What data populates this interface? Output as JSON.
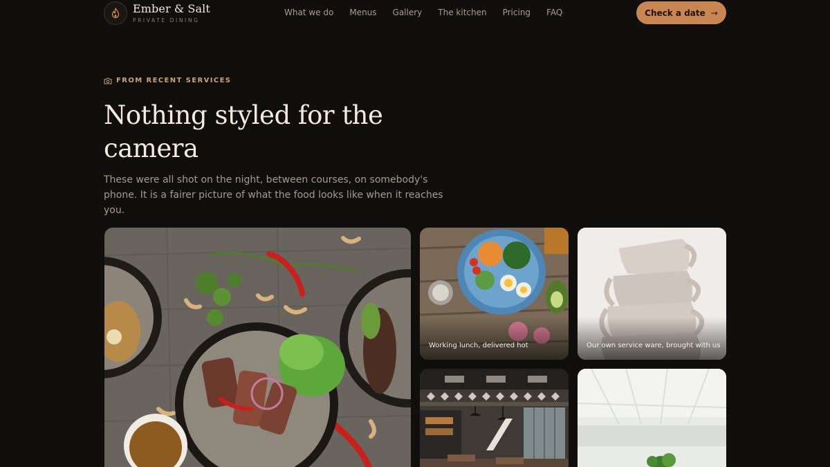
{
  "brand": {
    "name": "Ember & Salt",
    "tagline": "PRIVATE DINING",
    "icon": "flame-icon"
  },
  "nav": {
    "items": [
      "What we do",
      "Menus",
      "Gallery",
      "The kitchen",
      "Pricing",
      "FAQ"
    ]
  },
  "cta": {
    "label": "Check a date",
    "icon": "arrow-right-icon"
  },
  "section": {
    "eyebrow": "FROM RECENT SERVICES",
    "eyebrow_icon": "camera-icon",
    "title": "Nothing styled for the camera",
    "body": "These were all shot on the night, between courses, on somebody's phone. It is a fairer picture of what the food looks like when it reaches you."
  },
  "gallery": {
    "tiles": [
      {
        "caption": ""
      },
      {
        "caption": "Working lunch, delivered hot"
      },
      {
        "caption": "Our own service ware, brought with us"
      },
      {
        "caption": ""
      },
      {
        "caption": ""
      }
    ]
  },
  "colors": {
    "background": "#110f0d",
    "accent": "#c98552",
    "eyebrow": "#c9a37a",
    "heading": "#f3ebe0",
    "muted": "#a59b8f"
  }
}
